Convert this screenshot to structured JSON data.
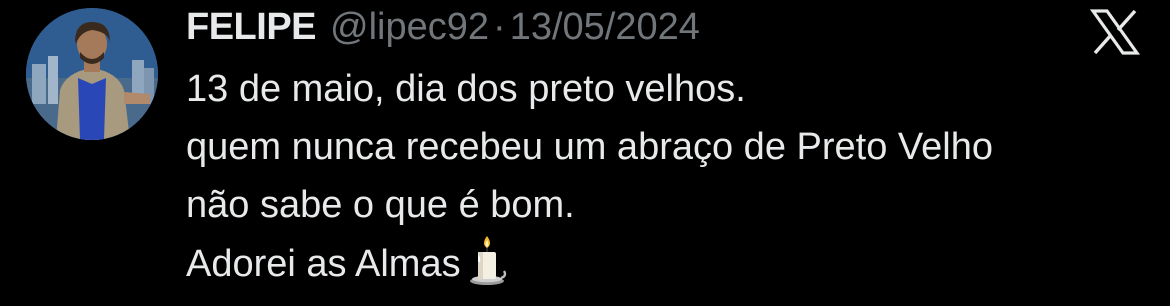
{
  "author": {
    "display_name": "FELIPE",
    "handle": "@lipec92",
    "separator": "·",
    "date": "13/05/2024"
  },
  "tweet": {
    "lines": [
      "13 de maio, dia dos preto velhos.",
      "quem nunca recebeu um abraço de Preto Velho",
      "não sabe o que é bom.",
      "Adorei as Almas"
    ],
    "trailing_emoji": "candle-emoji"
  },
  "icons": {
    "brand": "x-logo-icon",
    "avatar": "profile-avatar"
  },
  "colors": {
    "background": "#000000",
    "primary_text": "#e7e9ea",
    "secondary_text": "#71767b"
  }
}
